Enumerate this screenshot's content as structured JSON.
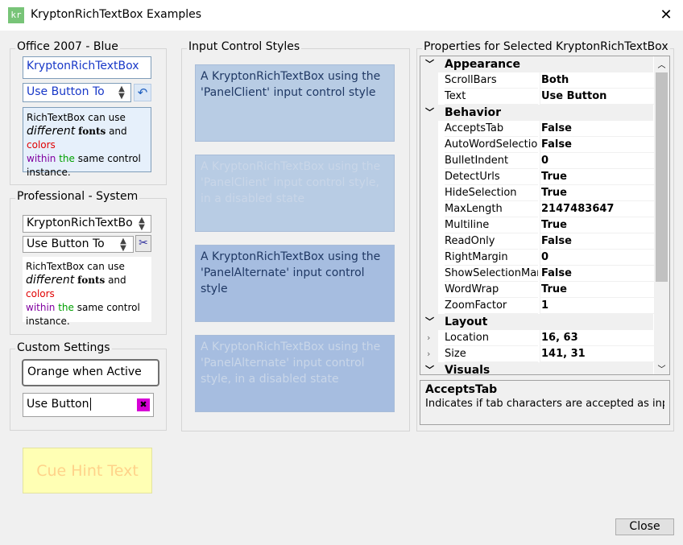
{
  "window": {
    "title": "KryptonRichTextBox Examples",
    "icon_text": "kr",
    "close_glyph": "✕"
  },
  "office": {
    "title": "Office 2007 - Blue",
    "textbox": "KryptonRichTextBox",
    "button_text": "Use Button To",
    "spin_up": "▲",
    "spin_down": "▼",
    "undo_glyph": "↶",
    "rich": {
      "p1": "RichTextBox can use ",
      "different": "different",
      "fonts": "fonts",
      "and": " and ",
      "colors": "colors",
      "within": "within",
      "the": " the",
      "rest": " same control instance."
    }
  },
  "professional": {
    "title": "Professional - System",
    "textbox": "KryptonRichTextBo",
    "button_text": "Use Button To",
    "cut_glyph": "✂",
    "rich": {
      "p1": "RichTextBox can use ",
      "different": "different",
      "fonts": "fonts",
      "and": " and ",
      "colors": "colors",
      "within": "within",
      "the": " the",
      "rest": " same control instance."
    }
  },
  "custom": {
    "title": "Custom Settings",
    "orange": "Orange when Active",
    "use_button": "Use Button",
    "x_glyph": "✖"
  },
  "cue": {
    "text": "Cue Hint Text"
  },
  "input_styles": {
    "title": "Input Control Styles",
    "boxes": [
      "A KryptonRichTextBox using the 'PanelClient' input control style",
      "A KryptonRichTextBox using the 'PanelClient' input control style, in a disabled state",
      "A KryptonRichTextBox using the 'PanelAlternate' input control style",
      "A KryptonRichTextBox using the 'PanelAlternate' input control style, in a disabled state"
    ]
  },
  "properties": {
    "title": "Properties for Selected KryptonRichTextBox",
    "rows": [
      {
        "kind": "cat",
        "label": "Appearance",
        "chev": "﹀"
      },
      {
        "kind": "prop",
        "name": "ScrollBars",
        "value": "Both"
      },
      {
        "kind": "prop",
        "name": "Text",
        "value": "Use Button"
      },
      {
        "kind": "cat",
        "label": "Behavior",
        "chev": "﹀"
      },
      {
        "kind": "prop",
        "name": "AcceptsTab",
        "value": "False"
      },
      {
        "kind": "prop",
        "name": "AutoWordSelection",
        "value": "False"
      },
      {
        "kind": "prop",
        "name": "BulletIndent",
        "value": "0"
      },
      {
        "kind": "prop",
        "name": "DetectUrls",
        "value": "True"
      },
      {
        "kind": "prop",
        "name": "HideSelection",
        "value": "True"
      },
      {
        "kind": "prop",
        "name": "MaxLength",
        "value": "2147483647"
      },
      {
        "kind": "prop",
        "name": "Multiline",
        "value": "True"
      },
      {
        "kind": "prop",
        "name": "ReadOnly",
        "value": "False"
      },
      {
        "kind": "prop",
        "name": "RightMargin",
        "value": "0"
      },
      {
        "kind": "prop",
        "name": "ShowSelectionMargin",
        "value": "False"
      },
      {
        "kind": "prop",
        "name": "WordWrap",
        "value": "True"
      },
      {
        "kind": "prop",
        "name": "ZoomFactor",
        "value": "1"
      },
      {
        "kind": "cat",
        "label": "Layout",
        "chev": "﹀"
      },
      {
        "kind": "prop",
        "name": "Location",
        "value": "16, 63",
        "exp": "›"
      },
      {
        "kind": "prop",
        "name": "Size",
        "value": "141, 31",
        "exp": "›"
      },
      {
        "kind": "cat",
        "label": "Visuals",
        "chev": "﹀"
      }
    ],
    "scroll_up": "︿",
    "scroll_down": "﹀",
    "desc_title": "AcceptsTab",
    "desc_text": "Indicates if tab characters are accepted as inp..."
  },
  "close_button": "Close",
  "colors": {
    "accent_blue": "#1838c8",
    "style_box": "#b8cce4",
    "cue_bg": "#ffffb4",
    "orange_text": "#ffd28a"
  }
}
